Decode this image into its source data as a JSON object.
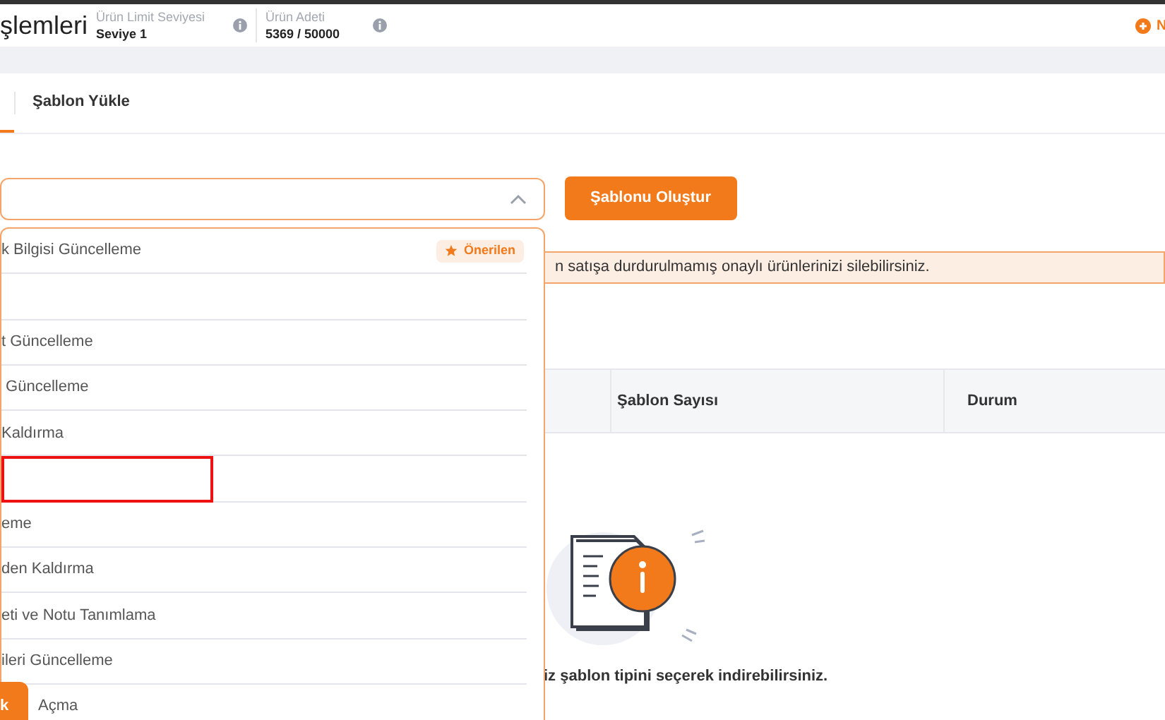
{
  "header": {
    "title": "şlemleri",
    "stats": [
      {
        "label": "Ürün Limit Seviyesi",
        "value": "Seviye 1"
      },
      {
        "label": "Ürün Adeti",
        "value": "5369 / 50000"
      }
    ],
    "action_label": "N"
  },
  "tabs": [
    {
      "selected": true
    },
    {
      "label": "Şablon Yükle",
      "selected": false
    }
  ],
  "template_select": {
    "expanded": true
  },
  "create_button": "Şablonu Oluştur",
  "alert": "n satışa durdurulmamış onaylı ürünlerinizi silebilirsiniz.",
  "table": {
    "columns": [
      "Şablon Sayısı",
      "Durum"
    ]
  },
  "empty_state": {
    "message": "iz şablon tipini seçerek indirebilirsiniz."
  },
  "dropdown_items": [
    {
      "label": "k Bilgisi Güncelleme",
      "badge": "Önerilen",
      "marked": false
    },
    {
      "marked": false
    },
    {
      "label": "t Güncelleme",
      "marked": false
    },
    {
      "label": " Güncelleme",
      "marked": false
    },
    {
      "label": "Kaldırma",
      "marked": false
    },
    {
      "marked": true
    },
    {
      "label": "eme",
      "marked": false
    },
    {
      "label": "den Kaldırma",
      "marked": false
    },
    {
      "label": "eti ve Notu Tanımlama",
      "marked": false
    },
    {
      "label": "ileri Güncelleme",
      "marked": false
    },
    {
      "label": "Açma",
      "marked": false
    }
  ],
  "floating_button": "k"
}
